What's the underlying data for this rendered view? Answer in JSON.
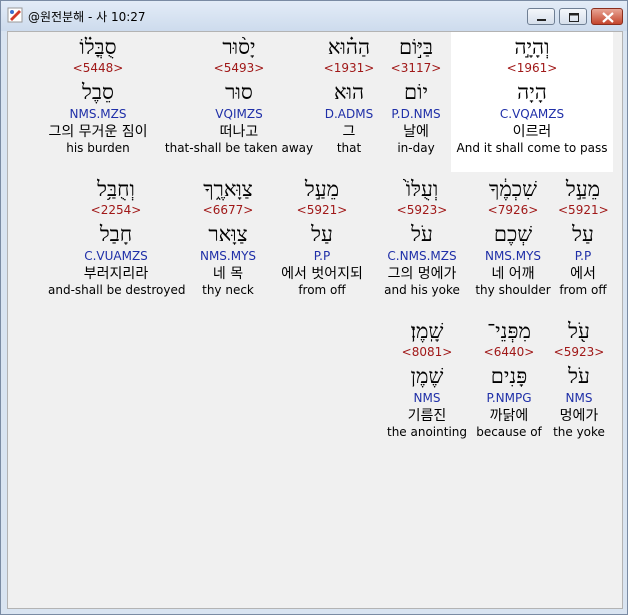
{
  "window": {
    "title": "@원전분해 - 사 10:27"
  },
  "rows": [
    [
      {
        "heb": "סֻבֳּל֗וֹ",
        "num": "<5448>",
        "lemma": "סֵבֶל",
        "morph": "NMS.MZS",
        "kor": "그의 무거운 짐이",
        "eng": "his burden"
      },
      {
        "heb": "יָס֨וּר",
        "num": "<5493>",
        "lemma": "סוּר",
        "morph": "VQIMZS",
        "kor": "떠나고",
        "eng": "that-shall be taken away"
      },
      {
        "heb": "הַה֗וּא",
        "num": "<1931>",
        "lemma": "הוּא",
        "morph": "D.ADMS",
        "kor": "그",
        "eng": "that"
      },
      {
        "heb": "בַּיּ֣וֹם",
        "num": "<3117>",
        "lemma": "יוֹם",
        "morph": "P.D.NMS",
        "kor": "날에",
        "eng": "in-day"
      },
      {
        "heb": "וְהָיָ֣ה",
        "num": "<1961>",
        "lemma": "הָיָה",
        "morph": "C.VQAMZS",
        "kor": "이르러",
        "eng": "And it shall come to pass"
      }
    ],
    [
      {
        "heb": "וְחֻבַּ֥ל",
        "num": "<2254>",
        "lemma": "חָבַל",
        "morph": "C.VUAMZS",
        "kor": "부러지리라",
        "eng": "and-shall be destroyed"
      },
      {
        "heb": "צַוָּארֶ֑ךָ",
        "num": "<6677>",
        "lemma": "צַוָּאר",
        "morph": "NMS.MYS",
        "kor": "네 목",
        "eng": "thy neck"
      },
      {
        "heb": "מֵעַ֣ל",
        "num": "<5921>",
        "lemma": "עַל",
        "morph": "P.P",
        "kor": "에서 벗어지되",
        "eng": "from off"
      },
      {
        "heb": "וְעֻלּוֹ֙",
        "num": "<5923>",
        "lemma": "עֹל",
        "morph": "C.NMS.MZS",
        "kor": "그의 멍에가",
        "eng": "and his yoke"
      },
      {
        "heb": "שִׁכְמֶ֔ךָ",
        "num": "<7926>",
        "lemma": "שְׁכֶם",
        "morph": "NMS.MYS",
        "kor": "네 어깨",
        "eng": "thy shoulder"
      },
      {
        "heb": "מֵעַ֣ל",
        "num": "<5921>",
        "lemma": "עַל",
        "morph": "P.P",
        "kor": "에서",
        "eng": "from off"
      }
    ],
    [
      {
        "heb": "שָֽׁמֶן׃",
        "num": "<8081>",
        "lemma": "שֶׁמֶן",
        "morph": "NMS",
        "kor": "기름진",
        "eng": "the anointing"
      },
      {
        "heb": "מִפְּנֵי־",
        "num": "<6440>",
        "lemma": "פָּנִים",
        "morph": "P.NMPG",
        "kor": "까닭에",
        "eng": "because of"
      },
      {
        "heb": "עֹ֖ל",
        "num": "<5923>",
        "lemma": "עֹל",
        "morph": "NMS",
        "kor": "멍에가",
        "eng": "the yoke"
      }
    ]
  ]
}
